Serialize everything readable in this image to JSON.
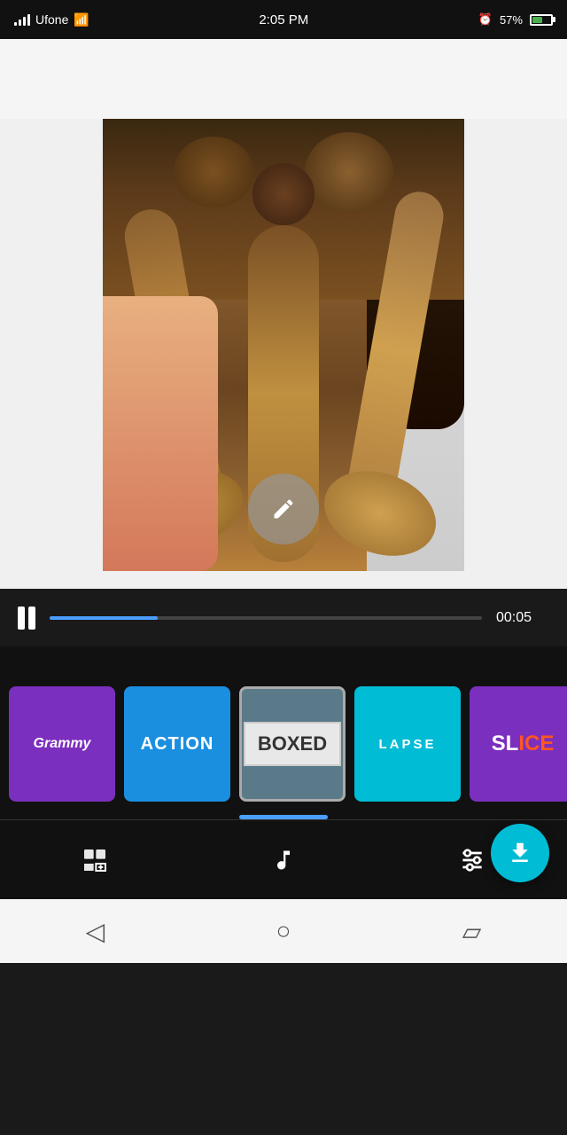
{
  "statusBar": {
    "carrier": "Ufone",
    "time": "2:05 PM",
    "alarm": true,
    "battery": "57%"
  },
  "playback": {
    "currentTime": "00:05",
    "progress": 25,
    "isPlaying": false
  },
  "filters": [
    {
      "id": "grammy",
      "label": "Grammy",
      "style": "purple"
    },
    {
      "id": "action",
      "label": "ACTION",
      "style": "blue"
    },
    {
      "id": "boxed",
      "label": "BOXED",
      "style": "gray",
      "selected": true
    },
    {
      "id": "lapse",
      "label": "LAPSE",
      "style": "cyan"
    },
    {
      "id": "slice",
      "label": "SLICE",
      "style": "purple-orange"
    }
  ],
  "toolbar": {
    "effects_label": "Effects",
    "music_label": "Music",
    "adjust_label": "Adjust"
  },
  "fab": {
    "label": "Download"
  }
}
